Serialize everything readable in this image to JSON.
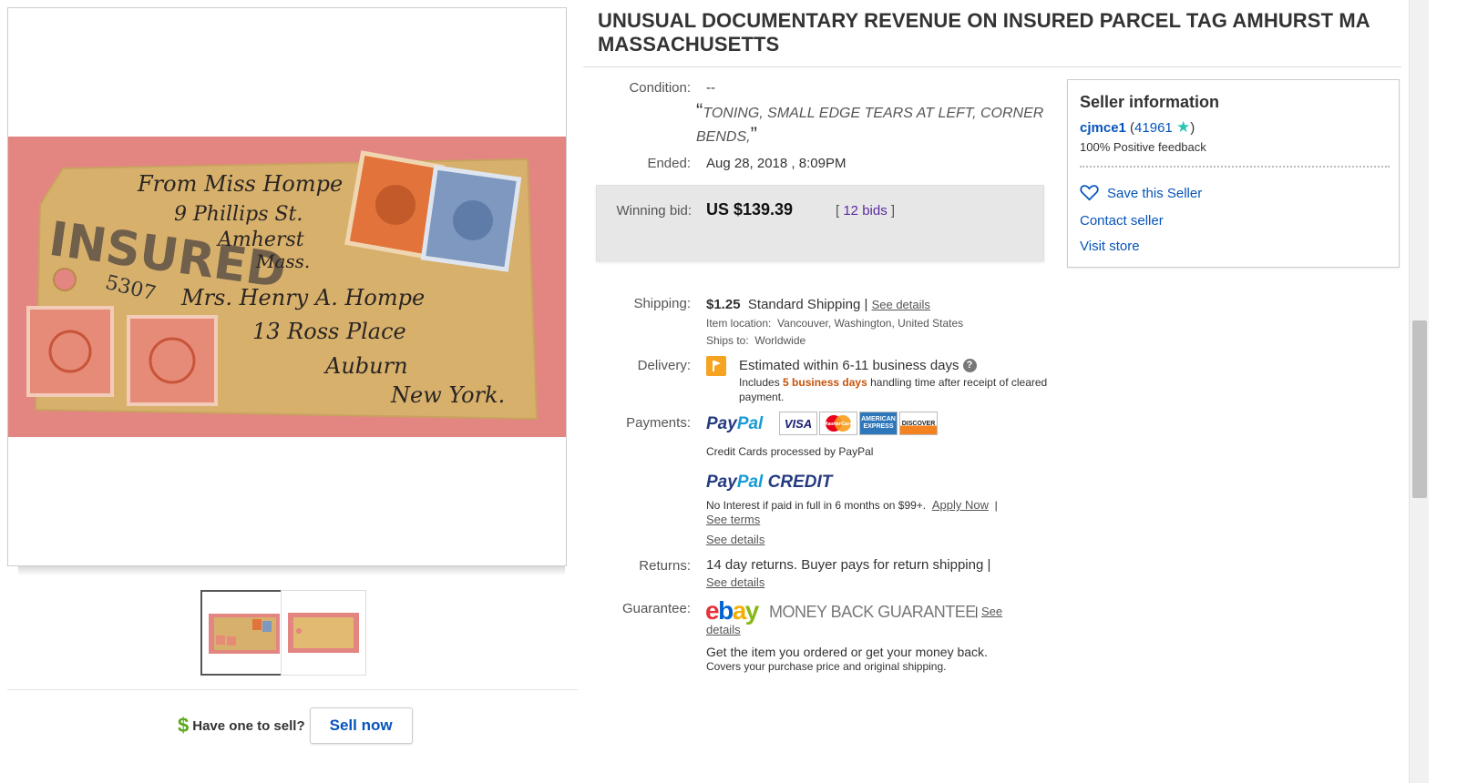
{
  "title": "UNUSUAL DOCUMENTARY REVENUE ON INSURED PARCEL TAG AMHURST MA MASSACHUSETTS",
  "details": {
    "condition_label": "Condition:",
    "condition_value": "--",
    "condition_note": "TONING, SMALL EDGE TEARS AT LEFT, CORNER BENDS,",
    "ended_label": "Ended:",
    "ended_value": "Aug 28, 2018 , 8:09PM",
    "winning_label": "Winning bid:",
    "winning_value": "US $139.39",
    "bid_bracket_open": "[",
    "bid_count": "12 bids",
    "bid_bracket_close": "]",
    "shipping_label": "Shipping:",
    "shipping_price": "$1.25",
    "shipping_method": "Standard Shipping",
    "shipping_sep": "|",
    "shipping_see_details": "See details",
    "item_location_label": "Item location:",
    "item_location": "Vancouver, Washington, United States",
    "ships_to_label": "Ships to:",
    "ships_to": "Worldwide",
    "delivery_label": "Delivery:",
    "delivery_estimate": "Estimated within 6-11 business days",
    "delivery_help": "?",
    "delivery_includes": "Includes",
    "delivery_handling_days": "5 business days",
    "delivery_handling_rest": "handling time after receipt of cleared payment.",
    "payments_label": "Payments:",
    "paypal_pay": "Pay",
    "paypal_pal": "Pal",
    "cards": [
      "VISA",
      "MasterCard",
      "AMERICAN EXPRESS",
      "DISCOVER"
    ],
    "credit_cards_note": "Credit Cards processed by PayPal",
    "paypal_credit": "CREDIT",
    "no_interest": "No Interest if paid in full in 6 months on $99+.",
    "apply_now": "Apply Now",
    "see_terms": "See terms",
    "payments_see_details": "See details",
    "returns_label": "Returns:",
    "returns_value": "14 day returns. Buyer pays for return shipping |",
    "returns_see_details": "See details",
    "guarantee_label": "Guarantee:",
    "ebay_letters": [
      "e",
      "b",
      "a",
      "y"
    ],
    "money_back": "MONEY BACK GUARANTEE",
    "guarantee_see": "See",
    "guarantee_details": "details",
    "guarantee_text_1": "Get the item you ordered or get your money back.",
    "guarantee_text_2": "Covers your purchase price and original shipping."
  },
  "seller": {
    "heading": "Seller information",
    "username": "cjmce1",
    "feedback_score": "41961",
    "positive": "100% Positive feedback",
    "save": "Save this Seller",
    "contact": "Contact seller",
    "store": "Visit store"
  },
  "sell": {
    "prompt": "Have one to sell?",
    "button": "Sell now"
  },
  "image": {
    "handwriting": [
      "From Miss Hompe",
      "9 Phillips St.",
      "Amherst",
      "Mass.",
      "Mrs. Henry A. Hompe",
      "13 Ross Place",
      "Auburn",
      "New York.",
      "INSURED",
      "5307"
    ]
  },
  "colors": {
    "link_blue": "#0654ba",
    "bid_purple": "#5a2aa0",
    "handling_orange": "#c6530c"
  }
}
